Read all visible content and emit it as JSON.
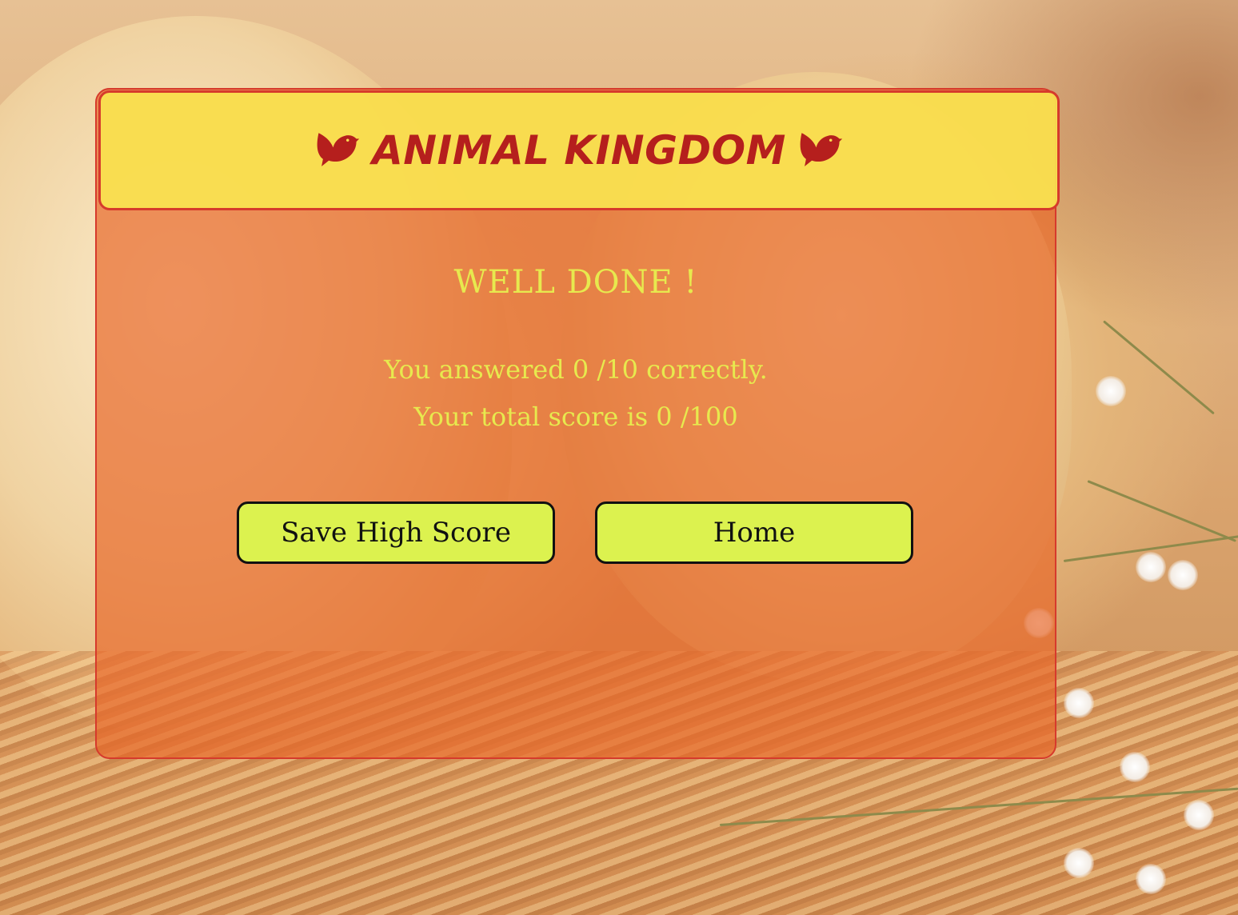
{
  "header": {
    "title": "ANIMAL KINGDOM",
    "icon": "dove-icon",
    "title_color": "#b51f1d",
    "background_color": "#f7e14f"
  },
  "result": {
    "heading": "WELL DONE !",
    "answered_text": "You answered 0 /10 correctly.",
    "score_text": "Your total score is 0 /100",
    "text_color": "#e7e94e"
  },
  "buttons": {
    "save_high_score": "Save High Score",
    "home": "Home",
    "background_color": "#dcf24f"
  },
  "card": {
    "background_color": "#e86628",
    "border_color": "#d63a2c"
  }
}
